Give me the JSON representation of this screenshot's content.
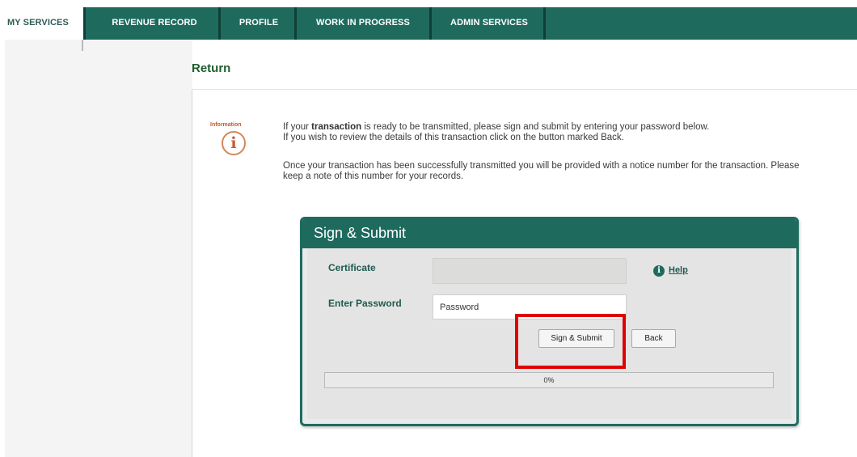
{
  "nav": {
    "tabs": [
      {
        "label": "MY SERVICES",
        "active": true
      },
      {
        "label": "REVENUE RECORD",
        "active": false
      },
      {
        "label": "PROFILE",
        "active": false
      },
      {
        "label": "WORK IN PROGRESS",
        "active": false
      },
      {
        "label": "ADMIN SERVICES",
        "active": false
      }
    ]
  },
  "page": {
    "title": "Return"
  },
  "info": {
    "icon_label": "Information",
    "icon": "info-circle-icon",
    "para1_pre": "If your ",
    "para1_bold": "transaction",
    "para1_post": " is ready to be transmitted, please sign and submit by entering your password below.",
    "para1_line2": "If you wish to review the details of this transaction click on the button marked Back.",
    "para2": "Once your transaction has been successfully transmitted you will be provided with a notice number for the transaction. Please keep a note of this number for your records."
  },
  "panel": {
    "title": "Sign & Submit",
    "certificate_label": "Certificate",
    "certificate_value": "",
    "password_label": "Enter Password",
    "password_value": "Password",
    "help_link": "Help",
    "sign_button": "Sign & Submit",
    "back_button": "Back",
    "progress_text": "0%",
    "progress_value": 0
  },
  "colors": {
    "brand_green": "#1e6b5e",
    "highlight_red": "#e00000",
    "info_orange": "#c8582c"
  }
}
